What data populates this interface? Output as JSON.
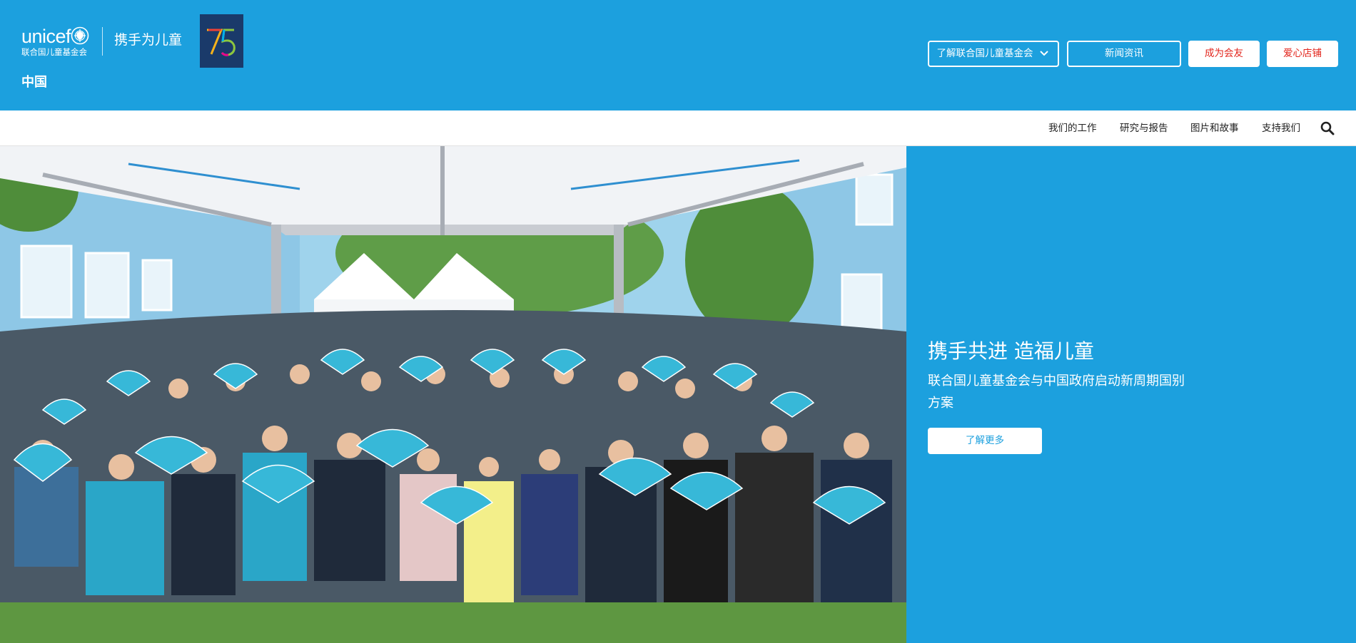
{
  "header": {
    "logo_wordmark": "unicef",
    "logo_subtitle": "联合国儿童基金会",
    "tagline": "携手为儿童",
    "anniversary_badge": "75",
    "country": "中国",
    "buttons": {
      "about": "了解联合国儿童基金会",
      "news": "新闻资讯",
      "member": "成为会友",
      "shop": "爱心店铺"
    }
  },
  "nav": {
    "items": [
      {
        "label": "我们的工作"
      },
      {
        "label": "研究与报告"
      },
      {
        "label": "图片和故事"
      },
      {
        "label": "支持我们"
      }
    ],
    "search_icon": "search-icon"
  },
  "hero": {
    "title": "携手共进 造福儿童",
    "subtitle": "联合国儿童基金会与中国政府启动新周期国别方案",
    "cta": "了解更多",
    "photo_alt": ""
  },
  "colors": {
    "brand_blue": "#1ca0de",
    "accent_red": "#e2231a",
    "white": "#ffffff"
  }
}
